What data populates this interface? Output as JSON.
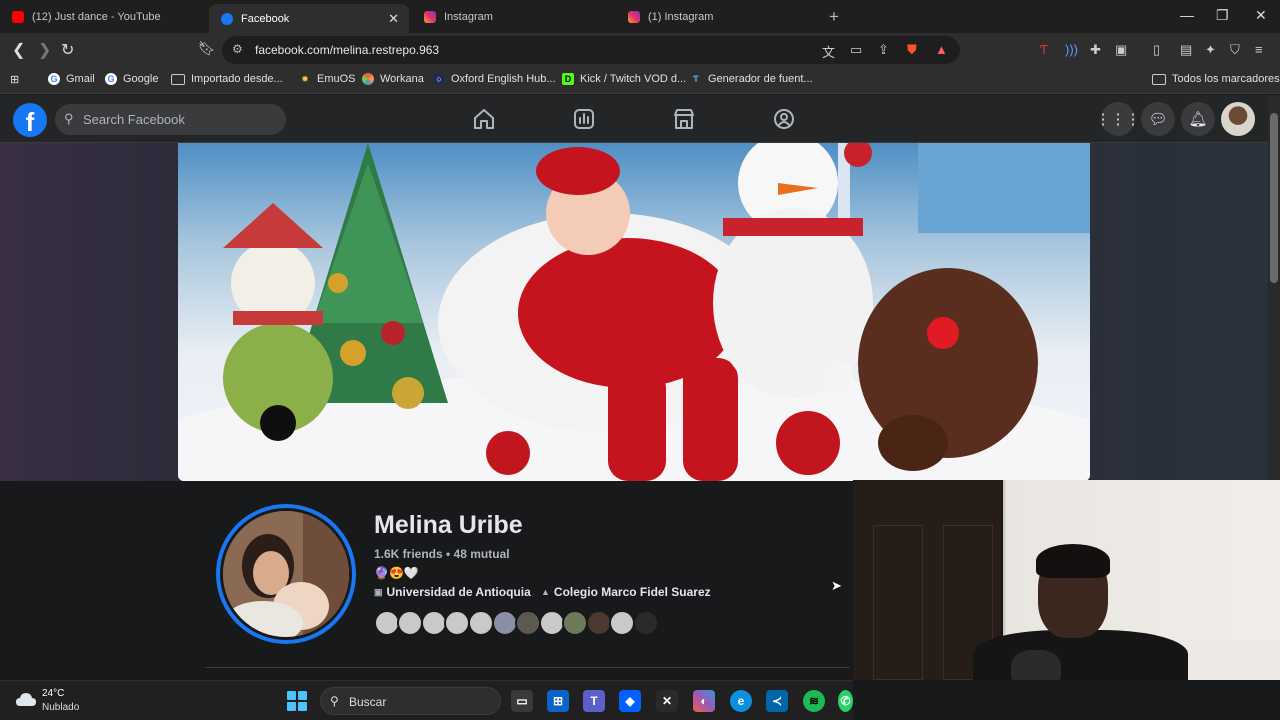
{
  "browser": {
    "tabs": [
      {
        "title": "(12) Just dance - YouTube",
        "favicon_color": "#ff0000"
      },
      {
        "title": "Facebook",
        "favicon_color": "#1877f2",
        "active": true
      },
      {
        "title": "Instagram",
        "favicon_color": "#e1306c"
      },
      {
        "title": "(1) Instagram",
        "favicon_color": "#e1306c"
      }
    ],
    "url": "facebook.com/melina.restrepo.963",
    "shield_count": "2",
    "bookmarks": [
      {
        "label": "Gmail",
        "icon": "google-icon"
      },
      {
        "label": "Google",
        "icon": "google-icon"
      },
      {
        "label": "Importado desde...",
        "icon": "folder-icon"
      },
      {
        "label": "EmuOS",
        "icon": "emuos-icon"
      },
      {
        "label": "Workana",
        "icon": "workana-icon"
      },
      {
        "label": "Oxford English Hub...",
        "icon": "oxford-icon"
      },
      {
        "label": "Kick / Twitch VOD d...",
        "icon": "kick-icon"
      },
      {
        "label": "Generador de fuent...",
        "icon": "font-generator-icon"
      }
    ],
    "all_bookmarks_label": "Todos los marcadores"
  },
  "facebook": {
    "search_placeholder": "Search Facebook",
    "profile": {
      "name": "Melina Uribe",
      "friends": "1.6K friends • 48 mutual",
      "emoji": "🔮😍🤍",
      "education": [
        "Universidad de Antioquia",
        "Colegio Marco Fidel Suarez"
      ],
      "mutual_friend_count_shown": 12
    }
  },
  "taskbar": {
    "temperature": "24°C",
    "condition": "Nublado",
    "search_placeholder": "Buscar"
  },
  "colors": {
    "facebook_blue": "#1877f2",
    "fb_background": "#18191a",
    "fb_surface": "#242526"
  }
}
